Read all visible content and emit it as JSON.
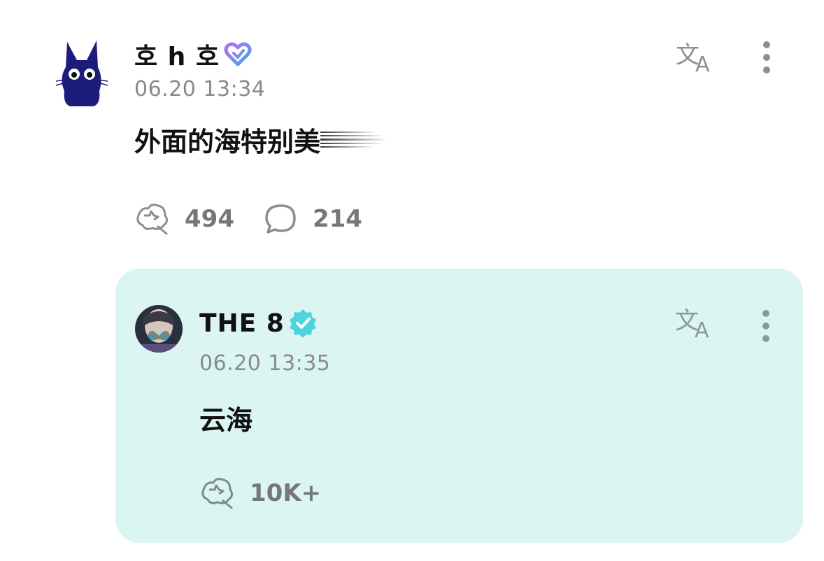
{
  "post": {
    "username": "호 h 호",
    "timestamp": "06.20 13:34",
    "text": "外面的海特别美",
    "likes": "494",
    "comments": "214"
  },
  "reply": {
    "username": "THE 8",
    "timestamp": "06.20 13:35",
    "text": "云海",
    "likes": "10K+"
  },
  "icons": {
    "translate": "translate-icon",
    "more": "more-vertical-icon",
    "like": "like-icon",
    "comment": "comment-icon",
    "verified": "verified-check-icon",
    "membership": "heart-badge-icon"
  },
  "colors": {
    "reply_background": "#dbf6f2",
    "verified": "#4fd3df",
    "cat_avatar": "#1e1c7a",
    "secondary_text": "#8a8a8a"
  }
}
